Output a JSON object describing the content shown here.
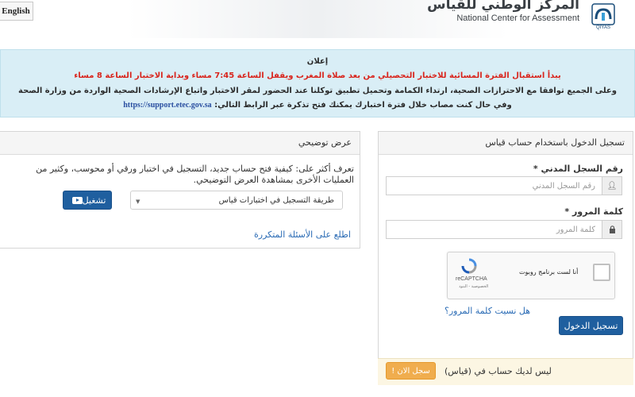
{
  "header": {
    "language_button": "English",
    "logo_ar": "المركز الوطني للقياس",
    "logo_en": "National Center for Assessment",
    "logo_mark_label": "QIYAS"
  },
  "announcement": {
    "title": "إعلان",
    "red_text": "يبدأ استقبال الفترة المسائية للاختبار التحصيلي من بعد صلاة المغرب ويقفل الساعة 7:45 مساء وبداية الاختبار الساعة 8 مساء",
    "line2": "وعلى الجميع توافقا مع الاحترازات الصحية، ارتداء الكمامة وتحميل تطبيق توكلنا عند الحضور لمقر الاختبار واتباع الإرشادات الصحية الواردة من وزارة الصحة",
    "line3_text": "وفي حال كنت مصاب خلال فترة اختبارك يمكنك فتح تذكرة عبر الرابط التالي:",
    "line3_link": "https://support.etec.gov.sa"
  },
  "login": {
    "heading": "تسجيل الدخول باستخدام حساب قياس",
    "id_label": "رقم السجل المدني",
    "id_placeholder": "رقم السجل المدني",
    "password_label": "كلمة المرور",
    "password_placeholder": "كلمة المرور",
    "required_mark": "*",
    "recaptcha_label": "أنا لست برنامج روبوت",
    "recaptcha_brand": "reCAPTCHA",
    "recaptcha_terms": "الخصوصية - البنود",
    "forgot_password": "هل نسيت كلمة المرور؟",
    "submit": "تسجيل الدخول",
    "no_account": "ليس لديك حساب في (قياس)",
    "register": "سجل الان !"
  },
  "demo": {
    "heading": "عرض توضيحي",
    "description": "تعرف أكثر على: كيفية فتح حساب جديد، التسجيل في اختبار ورقي أو محوسب، وكثير من العمليات الأخرى بمشاهدة العرض التوضيحي.",
    "select_value": "طريقة التسجيل في اختبارات قياس",
    "play_button": "تشغيل",
    "faq_link": "اطلع على الأسئلة المتكررة"
  },
  "colors": {
    "primary": "#1f5f9f",
    "warning": "#f0ad4e",
    "announcement_bg": "#d9eef6",
    "alert_red": "#d9251d"
  }
}
